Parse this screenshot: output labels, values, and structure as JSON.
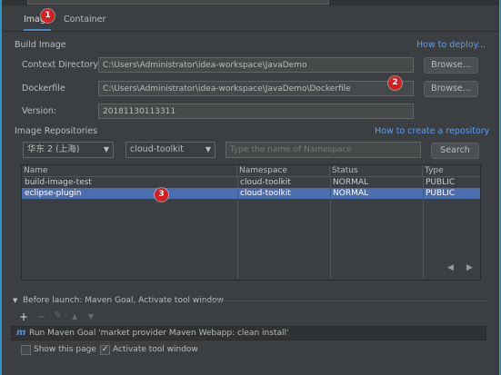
{
  "tabs": [
    {
      "label": "Image",
      "active": true
    },
    {
      "label": "Container",
      "active": false
    }
  ],
  "build_image": {
    "section_title": "Build Image",
    "how_to_link": "How to deploy...",
    "context_directory_label": "Context Directory",
    "context_directory_value": "C:\\Users\\Administrator\\idea-workspace\\JavaDemo",
    "dockerfile_label": "Dockerfile",
    "dockerfile_value": "C:\\Users\\Administrator\\idea-workspace\\JavaDemo\\Dockerfile",
    "version_label": "Version:",
    "version_value": "20181130113311",
    "browse_label": "Browse..."
  },
  "repositories": {
    "section_title": "Image  Repositories",
    "create_link": "How to create a repository",
    "region_value": "华东 2 (上海)",
    "namespace_value": "cloud-toolkit",
    "search_placeholder": "Type the name of Namespace",
    "search_button": "Search"
  },
  "table": {
    "columns": [
      "Name",
      "Namespace",
      "Status",
      "Type"
    ],
    "rows": [
      {
        "name": "build-image-test",
        "namespace": "cloud-toolkit",
        "status": "NORMAL",
        "type": "PUBLIC",
        "selected": false
      },
      {
        "name": "eclipse-plugin",
        "namespace": "cloud-toolkit",
        "status": "NORMAL",
        "type": "PUBLIC",
        "selected": true
      }
    ]
  },
  "badges": [
    "1",
    "2",
    "3"
  ],
  "before_launch": {
    "title": "Before launch: Maven Goal, Activate tool window",
    "task_text": "Run Maven Goal 'market provider Maven Webapp: clean install'",
    "show_page_label": "Show this page",
    "show_page_checked": false,
    "activate_label": "Activate tool window",
    "activate_checked": true
  },
  "icons": {
    "maven": "m",
    "add": "+",
    "remove": "−",
    "edit": "✎",
    "up": "▲",
    "down": "▼",
    "prev": "◀",
    "next": "▶",
    "expand": "▼",
    "check": "✓"
  },
  "colors": {
    "accent": "#4a88c7",
    "link": "#589df6",
    "selection": "#4b6eaf",
    "badge": "#d81e1e",
    "window_edge": "#3592c4"
  }
}
